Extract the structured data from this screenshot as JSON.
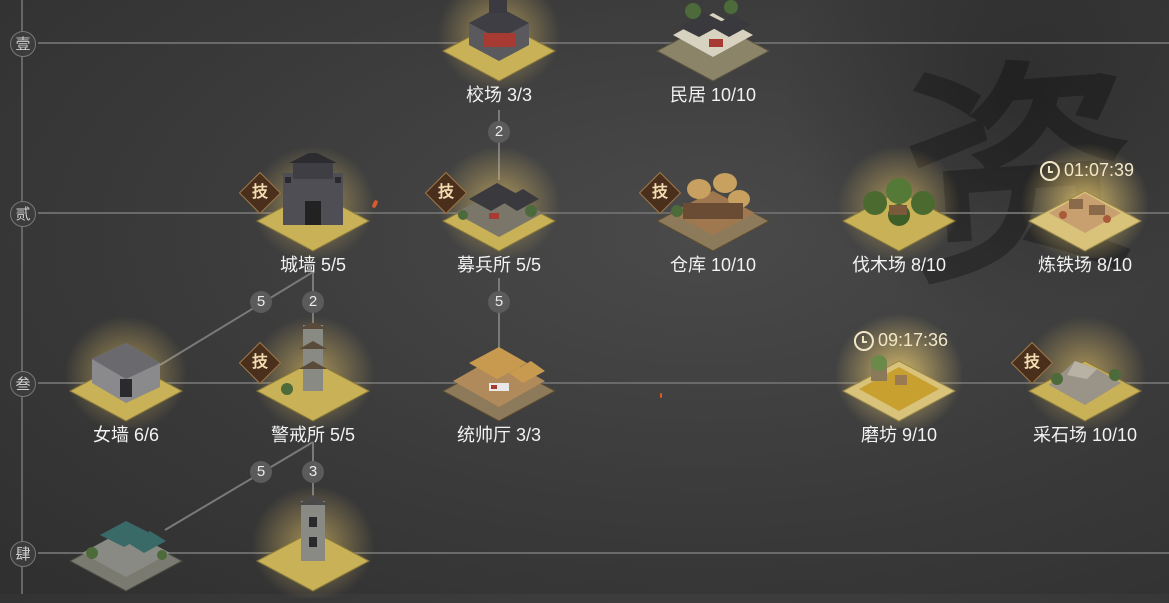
{
  "rows": [
    {
      "marker": "壹"
    },
    {
      "marker": "贰"
    },
    {
      "marker": "叁"
    },
    {
      "marker": "肆"
    }
  ],
  "background_glyph": "资",
  "connector_numbers": {
    "jiaochang_mubing": "2",
    "chengqiang_nvqiang": "5",
    "chengqiang_jingjie": "2",
    "mubing_tongshuai": "5",
    "jingjie_row4_left": "5",
    "jingjie_row4_tower": "3"
  },
  "buildings": {
    "jiaochang": {
      "label": "校场 3/3"
    },
    "minju": {
      "label": "民居 10/10"
    },
    "chengqiang": {
      "label": "城墙 5/5",
      "tech": "技"
    },
    "mubingsuo": {
      "label": "募兵所 5/5",
      "tech": "技"
    },
    "cangku": {
      "label": "仓库 10/10",
      "tech": "技"
    },
    "famuchang": {
      "label": "伐木场 8/10"
    },
    "liantiechang": {
      "label": "炼铁场 8/10",
      "timer": "01:07:39"
    },
    "nvqiang": {
      "label": "女墙 6/6"
    },
    "jingjiesuo": {
      "label": "警戒所 5/5",
      "tech": "技"
    },
    "tongshuaiting": {
      "label": "统帅厅 3/3"
    },
    "mofang": {
      "label": "磨坊 9/10",
      "timer": "09:17:36"
    },
    "caishichang": {
      "label": "采石场 10/10",
      "tech": "技"
    },
    "row4_left": {},
    "row4_tower": {}
  },
  "colors": {
    "tile_gold": "#c9b157",
    "tile_dark": "#8a7a3a",
    "line": "#6a6a6a",
    "label": "#f2f2f2",
    "timer": "#f2e6c6"
  }
}
